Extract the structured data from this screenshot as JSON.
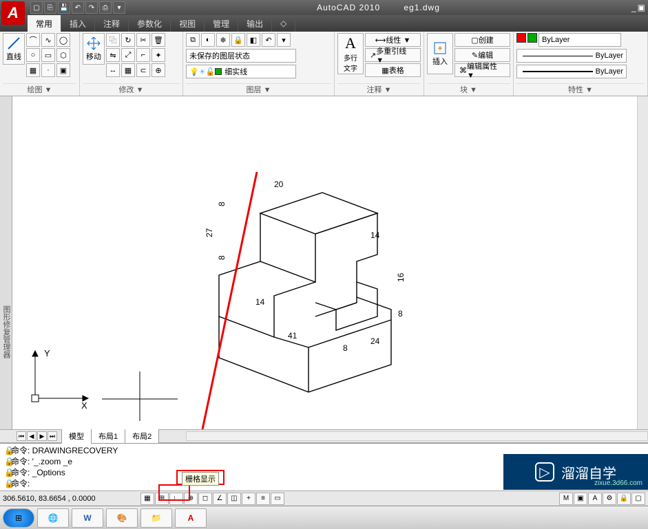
{
  "app": {
    "title": "AutoCAD 2010",
    "file": "eg1.dwg",
    "logo_letter": "A"
  },
  "menu": {
    "tabs": [
      "常用",
      "插入",
      "注释",
      "参数化",
      "视图",
      "管理",
      "输出"
    ],
    "active": "常用"
  },
  "ribbon": {
    "draw": {
      "label": "绘图 ▼",
      "line": "直线"
    },
    "modify": {
      "label": "修改 ▼",
      "move": "移动"
    },
    "layer": {
      "label": "图层 ▼",
      "state": "未保存的图层状态",
      "current": "细实线"
    },
    "annotation": {
      "label": "注释 ▼",
      "mtext": "多行\n文字",
      "linear": "线性 ▼",
      "leader": "多重引线 ▼",
      "table": "表格"
    },
    "block": {
      "label": "块 ▼",
      "insert": "插入",
      "create": "创建",
      "edit": "编辑",
      "attr": "编辑属性 ▼"
    },
    "properties": {
      "label": "特性 ▼",
      "bylayer": "ByLayer"
    }
  },
  "sidebar_title": "图形修复管理器",
  "tabs": {
    "model": "模型",
    "layout1": "布局1",
    "layout2": "布局2"
  },
  "cmd": {
    "l1": "命令: DRAWINGRECOVERY",
    "l2": "命令: '_.zoom _e",
    "l3": "命令: _Options",
    "l4": "命令:"
  },
  "status": {
    "coords": "306.5610, 83.6654 , 0.0000",
    "tooltip": "栅格显示"
  },
  "watermark": {
    "text": "溜溜自学",
    "url": "zixue.3d66.com"
  },
  "axes": {
    "x": "X",
    "y": "Y"
  },
  "dims": {
    "d20": "20",
    "d27": "27",
    "d8a": "8",
    "d8b": "8",
    "d14a": "14",
    "d41": "41",
    "d8c": "8",
    "d24": "24",
    "d14b": "14",
    "d16": "16",
    "d8d": "8"
  }
}
